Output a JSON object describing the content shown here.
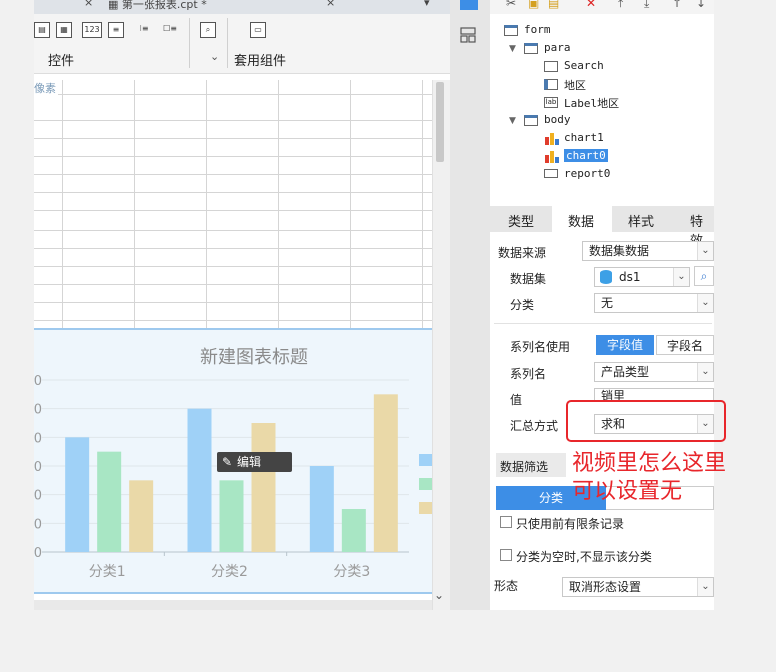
{
  "designer": {
    "tabs": [
      {
        "label": "×"
      },
      {
        "label": "第一张报表.cpt *"
      },
      {
        "label": "×"
      }
    ],
    "toolbar": {
      "control_label": "控件",
      "template_label": "套用组件",
      "icons": [
        "grid-icon",
        "calendar-icon",
        "number-field-icon",
        "text-area-icon",
        "radio-group-icon",
        "checkbox-group-icon",
        "tree-icon",
        "search-icon",
        "layout-icon"
      ],
      "number_glyph": "123"
    },
    "grid": {
      "unit_label": "像素"
    },
    "chart": {
      "title": "新建图表标题",
      "edit_label": "编辑",
      "y_ticks": [
        "0",
        "0",
        "0",
        "0",
        "0",
        "0",
        "0"
      ],
      "legend_colors": [
        "#9fd1f7",
        "#a8e6c4",
        "#ead9a8"
      ]
    }
  },
  "chart_data": {
    "type": "bar",
    "title": "新建图表标题",
    "categories": [
      "分类1",
      "分类2",
      "分类3"
    ],
    "series": [
      {
        "values": [
          4,
          5,
          3
        ],
        "color": "#9fd1f7"
      },
      {
        "values": [
          3.5,
          2.5,
          1.5
        ],
        "color": "#a8e6c4"
      },
      {
        "values": [
          2.5,
          4.5,
          5.5
        ],
        "color": "#ead9a8"
      }
    ],
    "ylim": [
      0,
      6
    ],
    "grid": true,
    "legend": "right"
  },
  "tree": {
    "form": "form",
    "para": "para",
    "search": "Search",
    "area": "地区",
    "label_area": "Label地区",
    "body": "body",
    "chart1": "chart1",
    "chart0": "chart0",
    "report0": "report0"
  },
  "props": {
    "tabs": [
      "类型",
      "数据",
      "样式",
      "特效"
    ],
    "data_source_label": "数据来源",
    "data_source_value": "数据集数据",
    "dataset_label": "数据集",
    "dataset_value": "ds1",
    "category_label": "分类",
    "category_value": "无",
    "series_name_use_label": "系列名使用",
    "toggle_field_value": "字段值",
    "toggle_field_name": "字段名",
    "series_name_label": "系列名",
    "series_name_value": "产品类型",
    "value_label": "值",
    "value_value": "销里",
    "summary_label": "汇总方式",
    "summary_value": "求和",
    "filter_label": "数据筛选",
    "filter_button": "分类",
    "only_top_label": "只使用前有限条记录",
    "skip_empty_label": "分类为空时,不显示该分类",
    "shape_label": "形态",
    "shape_value": "取消形态设置"
  },
  "annotation": {
    "line1": "视频里怎么这里",
    "line2": "可以设置无",
    "color": "#e8262b"
  }
}
